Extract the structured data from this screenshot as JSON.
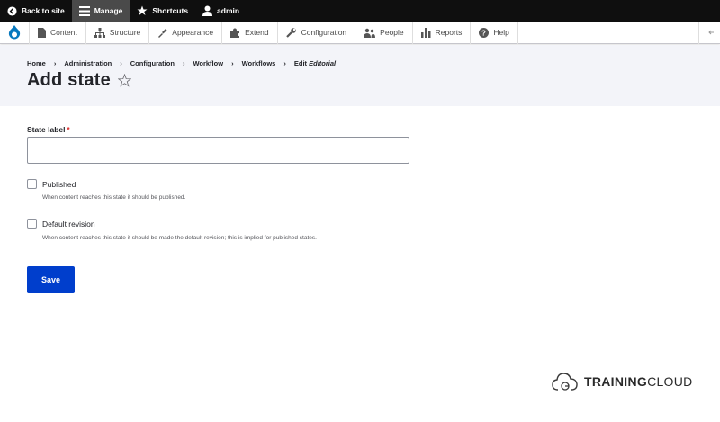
{
  "toolbar": {
    "back_label": "Back to site",
    "manage_label": "Manage",
    "shortcuts_label": "Shortcuts",
    "user_label": "admin"
  },
  "tray": {
    "items": [
      {
        "label": "Content",
        "icon": "document-icon"
      },
      {
        "label": "Structure",
        "icon": "structure-icon"
      },
      {
        "label": "Appearance",
        "icon": "paintbrush-icon"
      },
      {
        "label": "Extend",
        "icon": "puzzle-icon"
      },
      {
        "label": "Configuration",
        "icon": "wrench-icon"
      },
      {
        "label": "People",
        "icon": "people-icon"
      },
      {
        "label": "Reports",
        "icon": "bar-chart-icon"
      },
      {
        "label": "Help",
        "icon": "help-icon"
      }
    ]
  },
  "breadcrumb": {
    "items": [
      "Home",
      "Administration",
      "Configuration",
      "Workflow",
      "Workflows"
    ],
    "last_prefix": "Edit",
    "last_emphasis": "Editorial"
  },
  "page": {
    "title": "Add state"
  },
  "form": {
    "state_label": "State label",
    "required_marker": "*",
    "state_value": "",
    "published_label": "Published",
    "published_checked": false,
    "published_desc": "When content reaches this state it should be published.",
    "default_label": "Default revision",
    "default_checked": false,
    "default_desc": "When content reaches this state it should be made the default revision; this is implied for published states.",
    "save_label": "Save"
  },
  "brand": {
    "strong": "TRAINING",
    "rest": "CLOUD"
  },
  "colors": {
    "toolbar_bg": "#0f0f0f",
    "primary_button": "#003ecc",
    "header_bg": "#f3f4f9",
    "required": "#dc2323"
  }
}
